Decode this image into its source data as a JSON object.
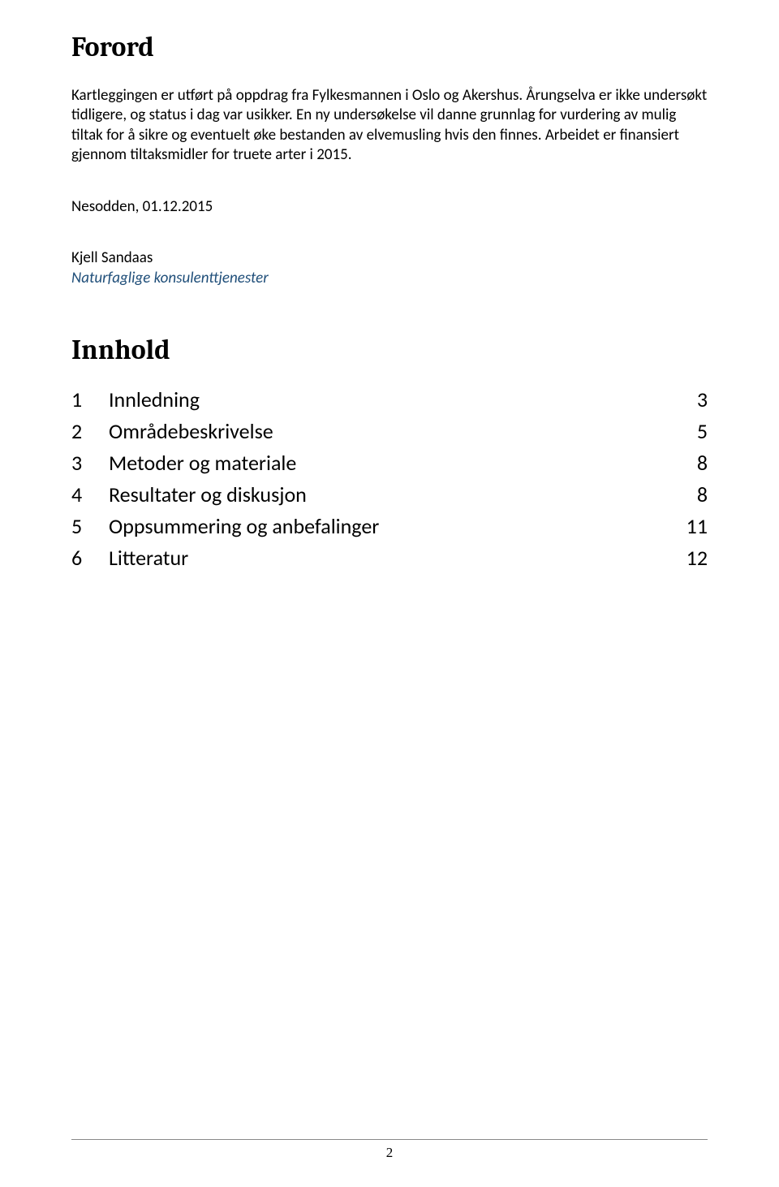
{
  "forord": {
    "heading": "Forord",
    "paragraph": "Kartleggingen er utført på oppdrag fra Fylkesmannen i Oslo og Akershus. Årungselva er ikke undersøkt tidligere, og status i dag var usikker. En ny undersøkelse vil danne grunnlag for vurdering av mulig tiltak for å sikre og eventuelt øke bestanden av elvemusling hvis den finnes. Arbeidet er finansiert gjennom tiltaksmidler for truete arter i 2015.",
    "date_line": "Nesodden, 01.12.2015",
    "author_name": "Kjell Sandaas",
    "author_org": "Naturfaglige konsulenttjenester"
  },
  "toc": {
    "heading": "Innhold",
    "items": [
      {
        "num": "1",
        "title": "Innledning",
        "page": "3"
      },
      {
        "num": "2",
        "title": "Områdebeskrivelse",
        "page": "5"
      },
      {
        "num": "3",
        "title": "Metoder og materiale",
        "page": "8"
      },
      {
        "num": "4",
        "title": "Resultater og diskusjon",
        "page": "8"
      },
      {
        "num": "5",
        "title": "Oppsummering og anbefalinger",
        "page": "11"
      },
      {
        "num": "6",
        "title": "Litteratur",
        "page": "12"
      }
    ]
  },
  "footer": {
    "page_number": "2"
  }
}
